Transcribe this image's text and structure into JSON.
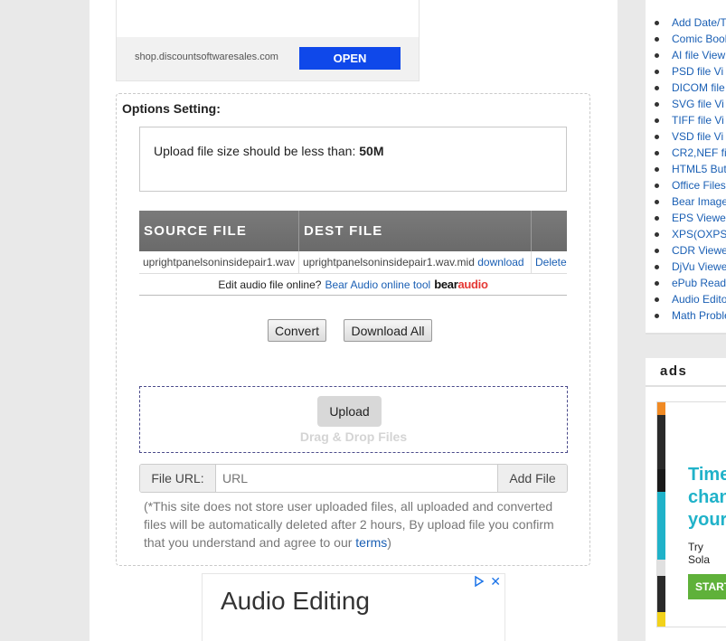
{
  "top_ad": {
    "domain": "shop.discountsoftwaresales.com",
    "open_label": "OPEN"
  },
  "options": {
    "title": "Options Setting:",
    "notice_prefix": "Upload file size should be less than: ",
    "notice_limit": "50M"
  },
  "file_table": {
    "headers": [
      "SOURCE FILE",
      "DEST FILE",
      ""
    ],
    "rows": [
      {
        "source": "uprightpanelsoninsidepair1.wav",
        "dest": "uprightpanelsoninsidepair1.wav.mid",
        "download_label": "download",
        "delete_label": "Delete"
      }
    ],
    "edit_prompt": "Edit audio file online?",
    "edit_link": "Bear Audio online tool",
    "logo_part1": "bear",
    "logo_part2": "audio"
  },
  "buttons": {
    "convert": "Convert",
    "download_all": "Download All"
  },
  "upload": {
    "button": "Upload",
    "hint": "Drag & Drop Files"
  },
  "url_row": {
    "label": "File URL:",
    "placeholder": "URL",
    "add_label": "Add File"
  },
  "disclaimer": {
    "text": "(*This site does not store user uploaded files, all uploaded and converted files will be automatically deleted after 2 hours, By upload file you confirm that you understand and agree to our ",
    "link": "terms",
    "tail": ")"
  },
  "bottom_ad": {
    "title": "Audio Editing"
  },
  "sidebar": {
    "items": [
      "Add Date/T",
      "Comic Bool",
      "AI file View",
      "PSD file Vi",
      "DICOM file",
      "SVG file Vi",
      "TIFF file Vi",
      "VSD file Vi",
      "CR2,NEF fi",
      "HTML5 But",
      "Office Files",
      "Bear Image",
      "EPS Viewe",
      "XPS(OXPS",
      "CDR Viewe",
      "DjVu Viewe",
      "ePub Read",
      "Audio Edito",
      "Math Proble"
    ]
  },
  "ads_panel": {
    "title": "ads",
    "headline_lines": [
      "Time",
      "chan",
      "your"
    ],
    "sub": "Try Sola",
    "cta": "START"
  },
  "colors": {
    "accent_blue": "#0f48ea",
    "link": "#1a5fb4",
    "table_header": "#707070",
    "ad_teal": "#20b2c9",
    "ad_green": "#5fb13a"
  }
}
